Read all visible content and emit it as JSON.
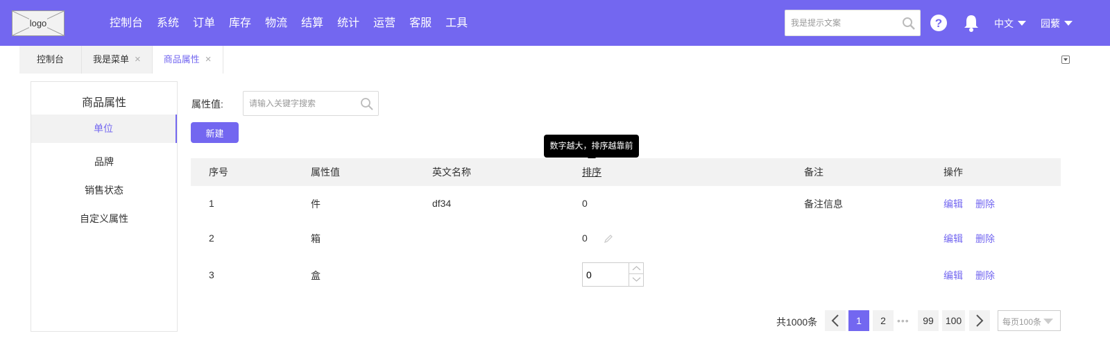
{
  "header": {
    "logo_text": "logo",
    "nav": [
      "控制台",
      "系统",
      "订单",
      "库存",
      "物流",
      "结算",
      "统计",
      "运营",
      "客服",
      "工具"
    ],
    "search_placeholder": "我是提示文案",
    "language": "中文",
    "user": "园蘩",
    "accent_color": "#7367f0"
  },
  "tabs": [
    {
      "label": "控制台",
      "closable": false,
      "active": false
    },
    {
      "label": "我是菜单",
      "closable": true,
      "active": false
    },
    {
      "label": "商品属性",
      "closable": true,
      "active": true
    }
  ],
  "tab_close_glyph": "×",
  "sidebar": {
    "title": "商品属性",
    "items": [
      {
        "label": "单位",
        "active": true
      },
      {
        "label": "品牌",
        "active": false
      },
      {
        "label": "销售状态",
        "active": false
      },
      {
        "label": "自定义属性",
        "active": false
      }
    ]
  },
  "filter": {
    "label": "属性值:",
    "placeholder": "请输入关键字搜索"
  },
  "new_button": "新建",
  "tooltip": "数字越大，排序越靠前",
  "table": {
    "columns": [
      "序号",
      "属性值",
      "英文名称",
      "排序",
      "备注",
      "操作"
    ],
    "rows": [
      {
        "index": "1",
        "value": "件",
        "english": "df34",
        "sort": "0",
        "remark": "备注信息"
      },
      {
        "index": "2",
        "value": "箱",
        "english": "",
        "sort": "0",
        "remark": ""
      },
      {
        "index": "3",
        "value": "盒",
        "english": "",
        "sort": "0",
        "remark": ""
      }
    ],
    "edit_label": "编辑",
    "delete_label": "删除"
  },
  "pagination": {
    "total": "共1000条",
    "pages": [
      "1",
      "2",
      "99",
      "100"
    ],
    "current": "1",
    "ellipsis": "•••",
    "page_size": "每页100条"
  }
}
